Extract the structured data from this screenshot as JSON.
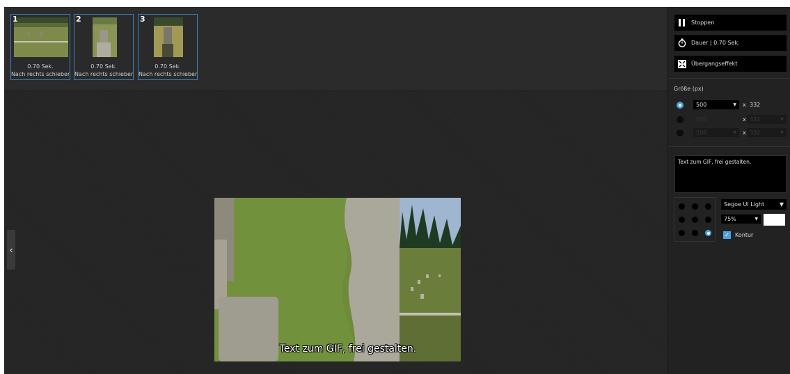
{
  "frames": [
    {
      "number": "1",
      "duration": "0.70 Sek.",
      "effect": "Nach rechts schieben"
    },
    {
      "number": "2",
      "duration": "0.70 Sek.",
      "effect": "Nach rechts schieben"
    },
    {
      "number": "3",
      "duration": "0.70 Sek.",
      "effect": "Nach rechts schieben"
    }
  ],
  "preview": {
    "caption": "Text zum GIF, frei gestalten."
  },
  "sidebar": {
    "stop_label": "Stoppen",
    "duration_label": "Dauer | 0.70 Sek.",
    "transition_label": "Übergangseffekt",
    "size_title": "Größe (px)",
    "size_rows": [
      {
        "width": "500",
        "x": "x",
        "height": "332",
        "selected": true
      },
      {
        "width": "500",
        "x": "x",
        "height": "332",
        "selected": false
      },
      {
        "width": "500",
        "x": "x",
        "height": "332",
        "selected": false
      }
    ],
    "text_value": "Text zum GIF, frei gestalten.",
    "font_name": "Segoe UI Light",
    "font_size": "75%",
    "text_color": "#ffffff",
    "contour_label": "Kontur",
    "contour_checked": true,
    "selected_position": "bottom-right"
  },
  "colors": {
    "accent": "#4ba3e0",
    "frame_border": "#3d7fbf"
  }
}
